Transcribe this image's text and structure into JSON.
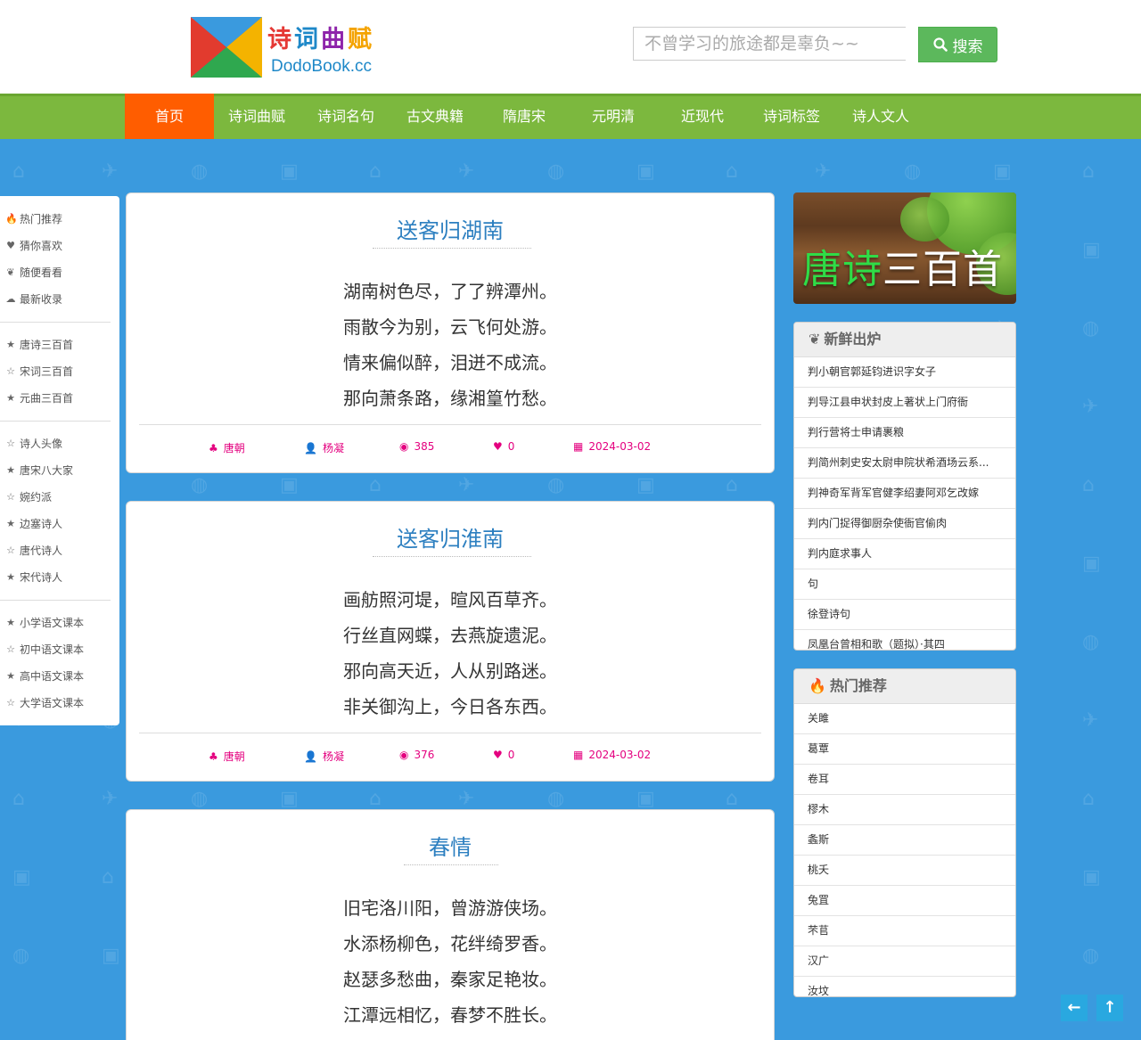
{
  "header": {
    "logo_title_chars": [
      "诗",
      "词",
      "曲",
      "赋"
    ],
    "logo_title_colors": [
      "#e53935",
      "#1e88c8",
      "#8e24aa",
      "#f4a300"
    ],
    "logo_sub": "DodoBook.cc",
    "search_placeholder": "不曾学习的旅途都是辜负~~",
    "search_label": "搜索"
  },
  "nav": [
    "首页",
    "诗词曲赋",
    "诗词名句",
    "古文典籍",
    "隋唐宋",
    "元明清",
    "近现代",
    "诗词标签",
    "诗人文人"
  ],
  "leftbar": {
    "group1": [
      {
        "icon": "🔥",
        "label": "热门推荐"
      },
      {
        "icon": "♥",
        "label": "猜你喜欢"
      },
      {
        "icon": "❦",
        "label": "随便看看"
      },
      {
        "icon": "☁",
        "label": "最新收录"
      }
    ],
    "group2": [
      {
        "icon": "★",
        "label": "唐诗三百首"
      },
      {
        "icon": "☆",
        "label": "宋词三百首"
      },
      {
        "icon": "★",
        "label": "元曲三百首"
      }
    ],
    "group3": [
      {
        "icon": "☆",
        "label": "诗人头像"
      },
      {
        "icon": "★",
        "label": "唐宋八大家"
      },
      {
        "icon": "☆",
        "label": "婉约派"
      },
      {
        "icon": "★",
        "label": "边塞诗人"
      },
      {
        "icon": "☆",
        "label": "唐代诗人"
      },
      {
        "icon": "★",
        "label": "宋代诗人"
      }
    ],
    "group4": [
      {
        "icon": "★",
        "label": "小学语文课本"
      },
      {
        "icon": "☆",
        "label": "初中语文课本"
      },
      {
        "icon": "★",
        "label": "高中语文课本"
      },
      {
        "icon": "☆",
        "label": "大学语文课本"
      }
    ]
  },
  "poems": [
    {
      "title": "送客归湖南",
      "lines": [
        "湖南树色尽，了了辨潭州。",
        "雨散今为别，云飞何处游。",
        "情来偏似醉，泪迸不成流。",
        "那向萧条路，缘湘篁竹愁。"
      ],
      "dynasty": "唐朝",
      "author": "杨凝",
      "views": "385",
      "likes": "0",
      "date": "2024-03-02"
    },
    {
      "title": "送客归淮南",
      "lines": [
        "画舫照河堤，暄风百草齐。",
        "行丝直网蝶，去燕旋遗泥。",
        "邪向高天近，人从别路迷。",
        "非关御沟上，今日各东西。"
      ],
      "dynasty": "唐朝",
      "author": "杨凝",
      "views": "376",
      "likes": "0",
      "date": "2024-03-02"
    },
    {
      "title": "春情",
      "lines": [
        "旧宅洛川阳，曾游游侠场。",
        "水添杨柳色，花绊绮罗香。",
        "赵瑟多愁曲，秦家足艳妆。",
        "江潭远相忆，春梦不胜长。"
      ]
    }
  ],
  "banner": {
    "green": "唐诗",
    "white": "三百首"
  },
  "fresh": {
    "title": "新鲜出炉",
    "items": [
      "判小朝官郭延钧进识字女子",
      "判导江县申状封皮上著状上门府衙",
      "判行营将士申请裹粮",
      "判简州刺史安太尉申院状希酒场云系...",
      "判神奇军背军官健李绍妻阿邓乞改嫁",
      "判内门捉得御厨杂使衙官偷肉",
      "判内庭求事人",
      "句",
      "徐登诗句",
      "凤凰台曾相和歌（题拟）·其四"
    ]
  },
  "hot": {
    "title": "热门推荐",
    "items": [
      "关雎",
      "葛覃",
      "卷耳",
      "樛木",
      "螽斯",
      "桃夭",
      "兔罝",
      "芣苢",
      "汉广",
      "汝坟"
    ]
  }
}
